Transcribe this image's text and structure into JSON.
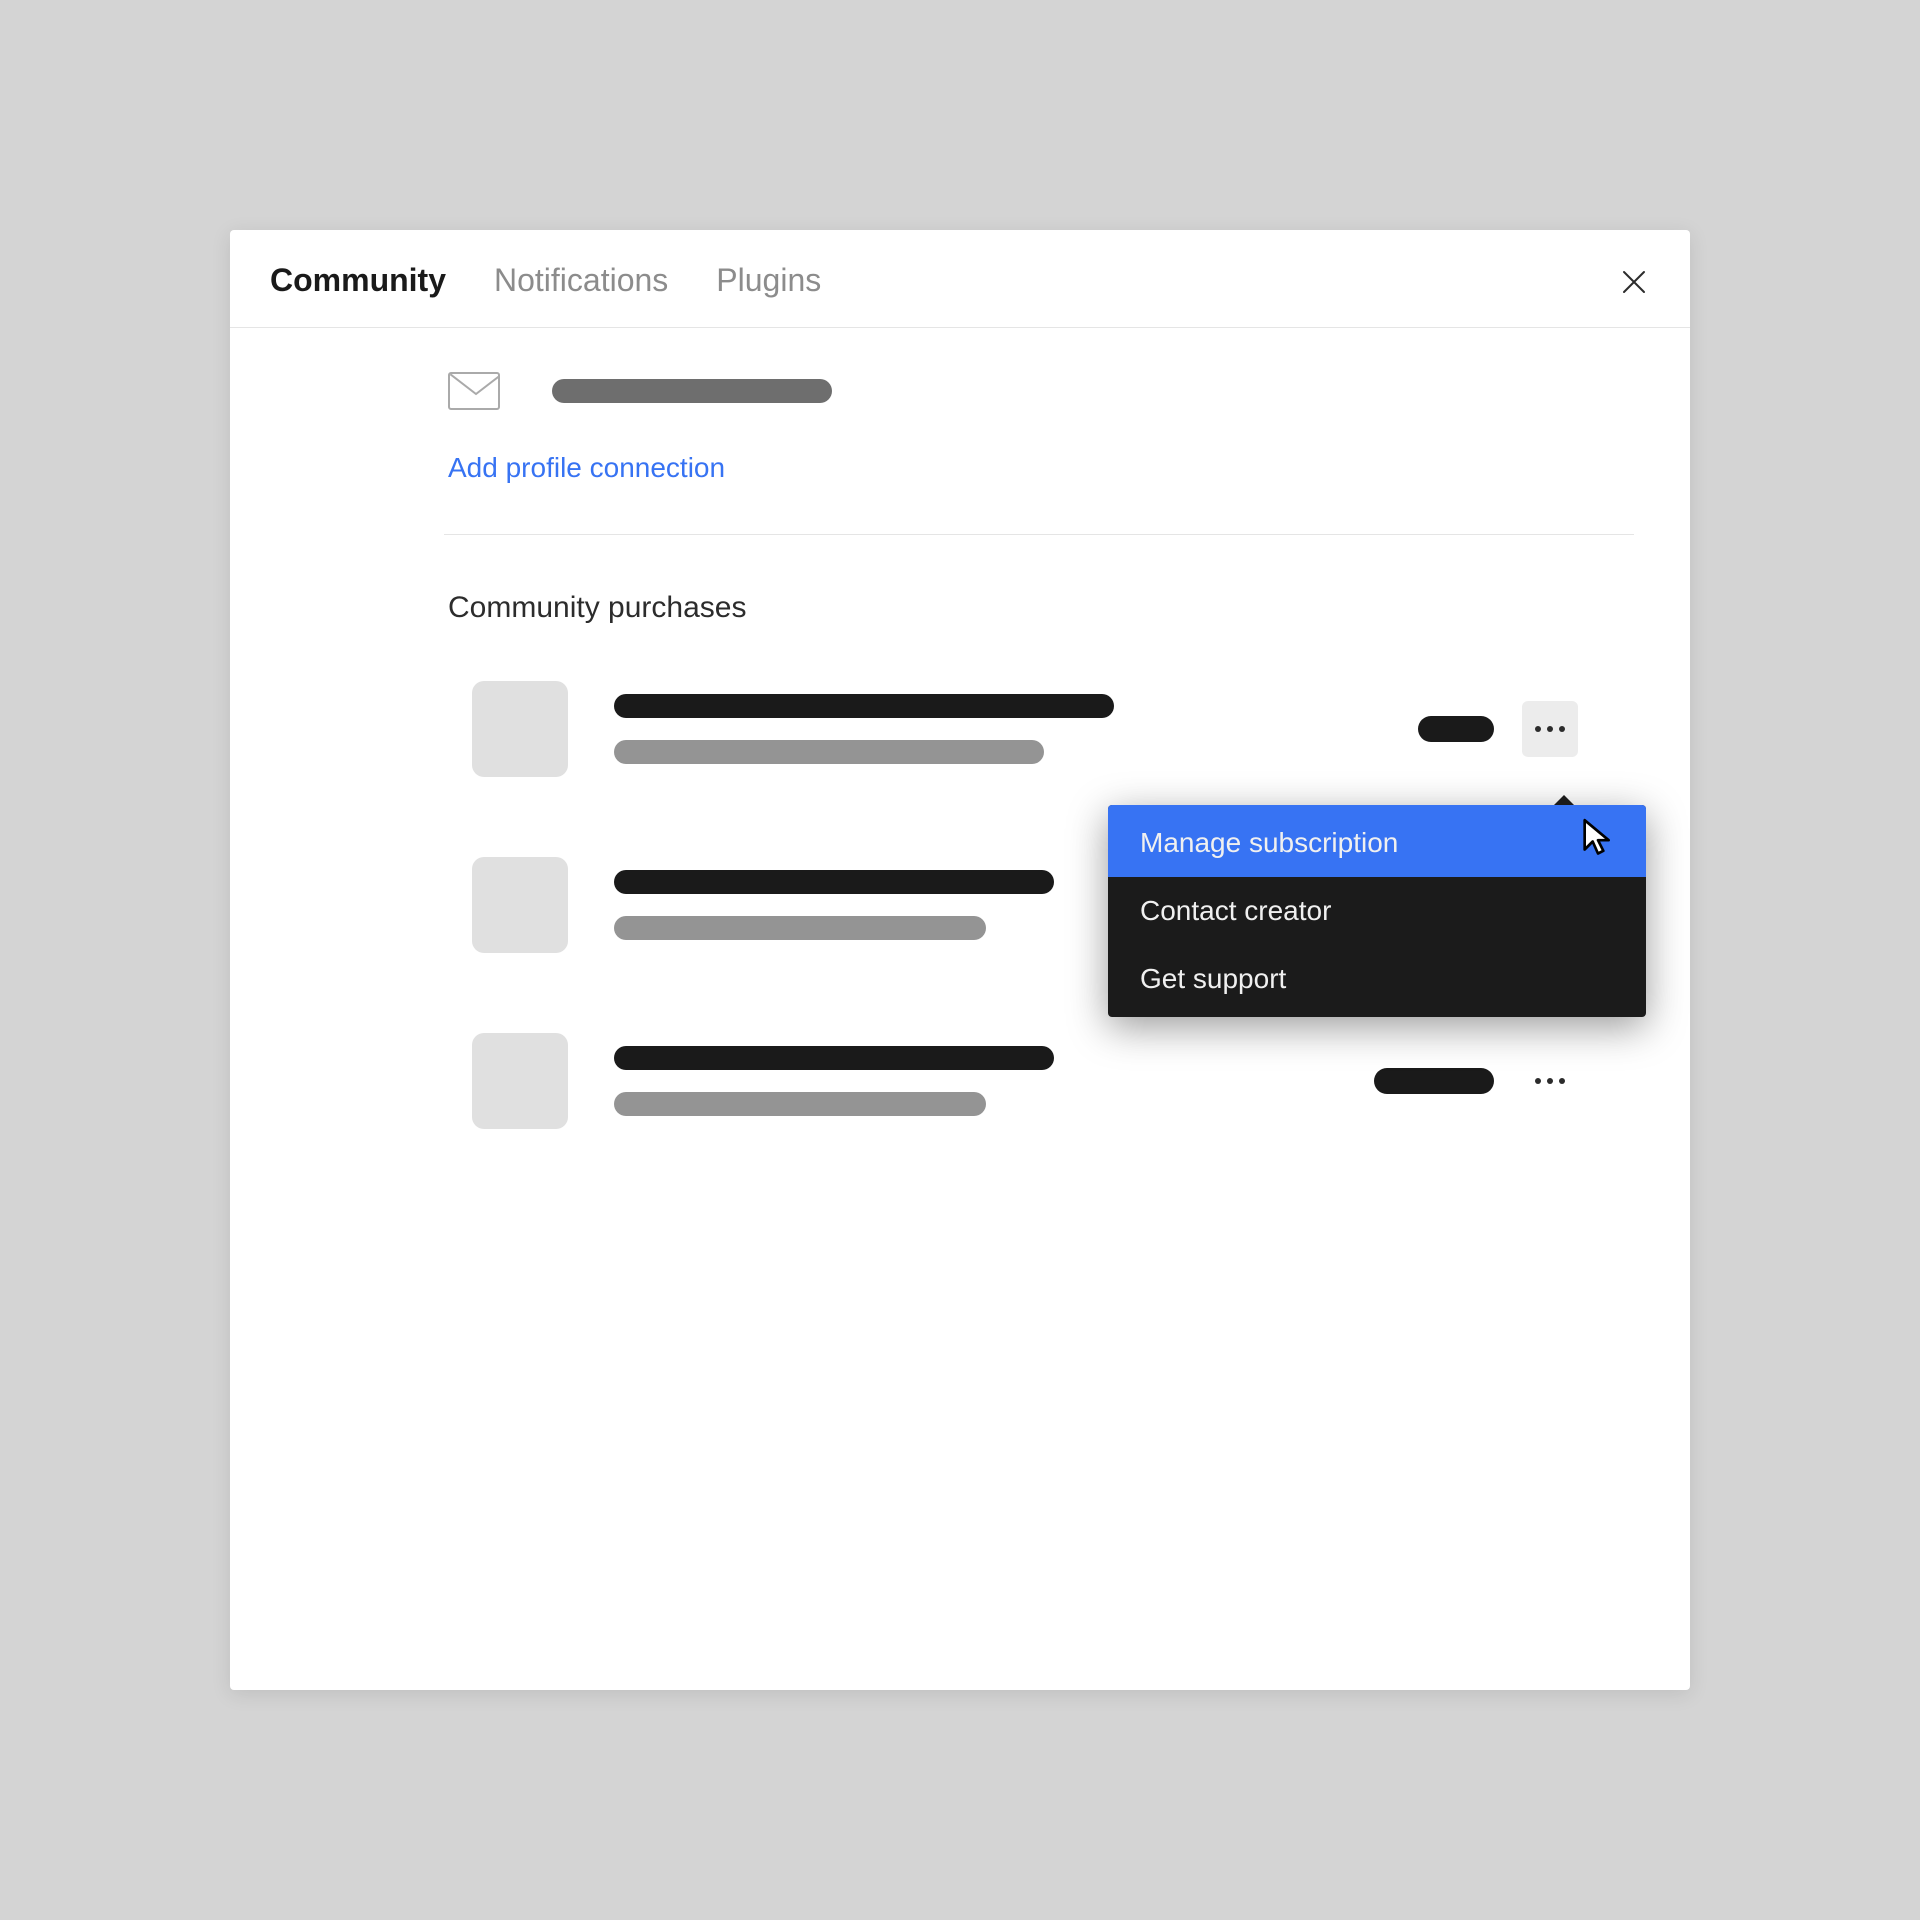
{
  "header": {
    "tabs": {
      "community": "Community",
      "notifications": "Notifications",
      "plugins": "Plugins"
    }
  },
  "profile": {
    "add_connection_link": "Add profile connection"
  },
  "purchases": {
    "section_title": "Community purchases",
    "dropdown": {
      "manage_subscription": "Manage subscription",
      "contact_creator": "Contact creator",
      "get_support": "Get support"
    }
  }
}
